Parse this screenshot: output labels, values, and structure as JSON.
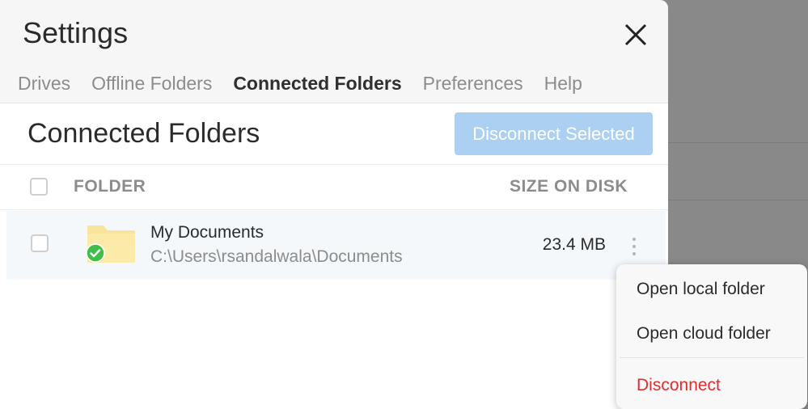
{
  "dialog": {
    "title": "Settings",
    "close_icon": "close-icon"
  },
  "tabs": [
    {
      "label": "Drives",
      "active": false
    },
    {
      "label": "Offline Folders",
      "active": false
    },
    {
      "label": "Connected Folders",
      "active": true
    },
    {
      "label": "Preferences",
      "active": false
    },
    {
      "label": "Help",
      "active": false
    }
  ],
  "section": {
    "title": "Connected Folders",
    "disconnect_selected_label": "Disconnect Selected"
  },
  "table": {
    "columns": {
      "folder": "FOLDER",
      "size": "SIZE ON DISK"
    },
    "rows": [
      {
        "name": "My Documents",
        "path": "C:\\Users\\rsandalwala\\Documents",
        "size": "23.4 MB",
        "status_icon": "synced-check-icon",
        "icon": "folder-icon",
        "selected": false
      }
    ]
  },
  "context_menu": {
    "items": [
      {
        "label": "Open local folder"
      },
      {
        "label": "Open cloud folder"
      },
      {
        "label": "Disconnect",
        "danger": true
      }
    ]
  },
  "colors": {
    "accent_disabled": "#abd0f2",
    "danger": "#e02e2e",
    "sync_ok": "#3fbf4a",
    "folder": "#f8e49a"
  }
}
